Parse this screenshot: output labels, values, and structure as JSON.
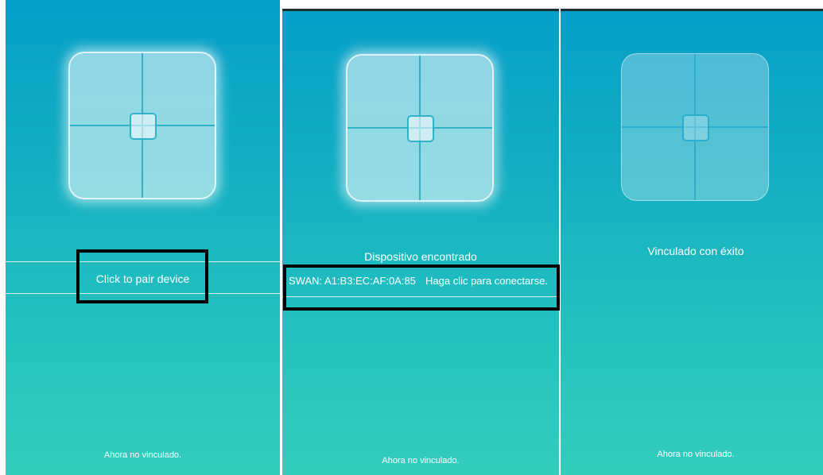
{
  "panel1": {
    "pair_button": "Click to pair device",
    "status": "Ahora no vinculado."
  },
  "panel2": {
    "found_title": "Dispositivo encontrado",
    "device_name": "SWAN: A1:B3:EC:AF:0A:85",
    "connect_hint": "Haga clic para conectarse.",
    "status": "Ahora no vinculado."
  },
  "panel3": {
    "success_title": "Vinculado con éxito",
    "status": "Ahora no vinculado."
  },
  "colors": {
    "gradient_top": "#069fc8",
    "gradient_bottom": "#33cdbd",
    "highlight_border": "#000000"
  },
  "icons": {
    "scale": "smart-scale-icon"
  }
}
